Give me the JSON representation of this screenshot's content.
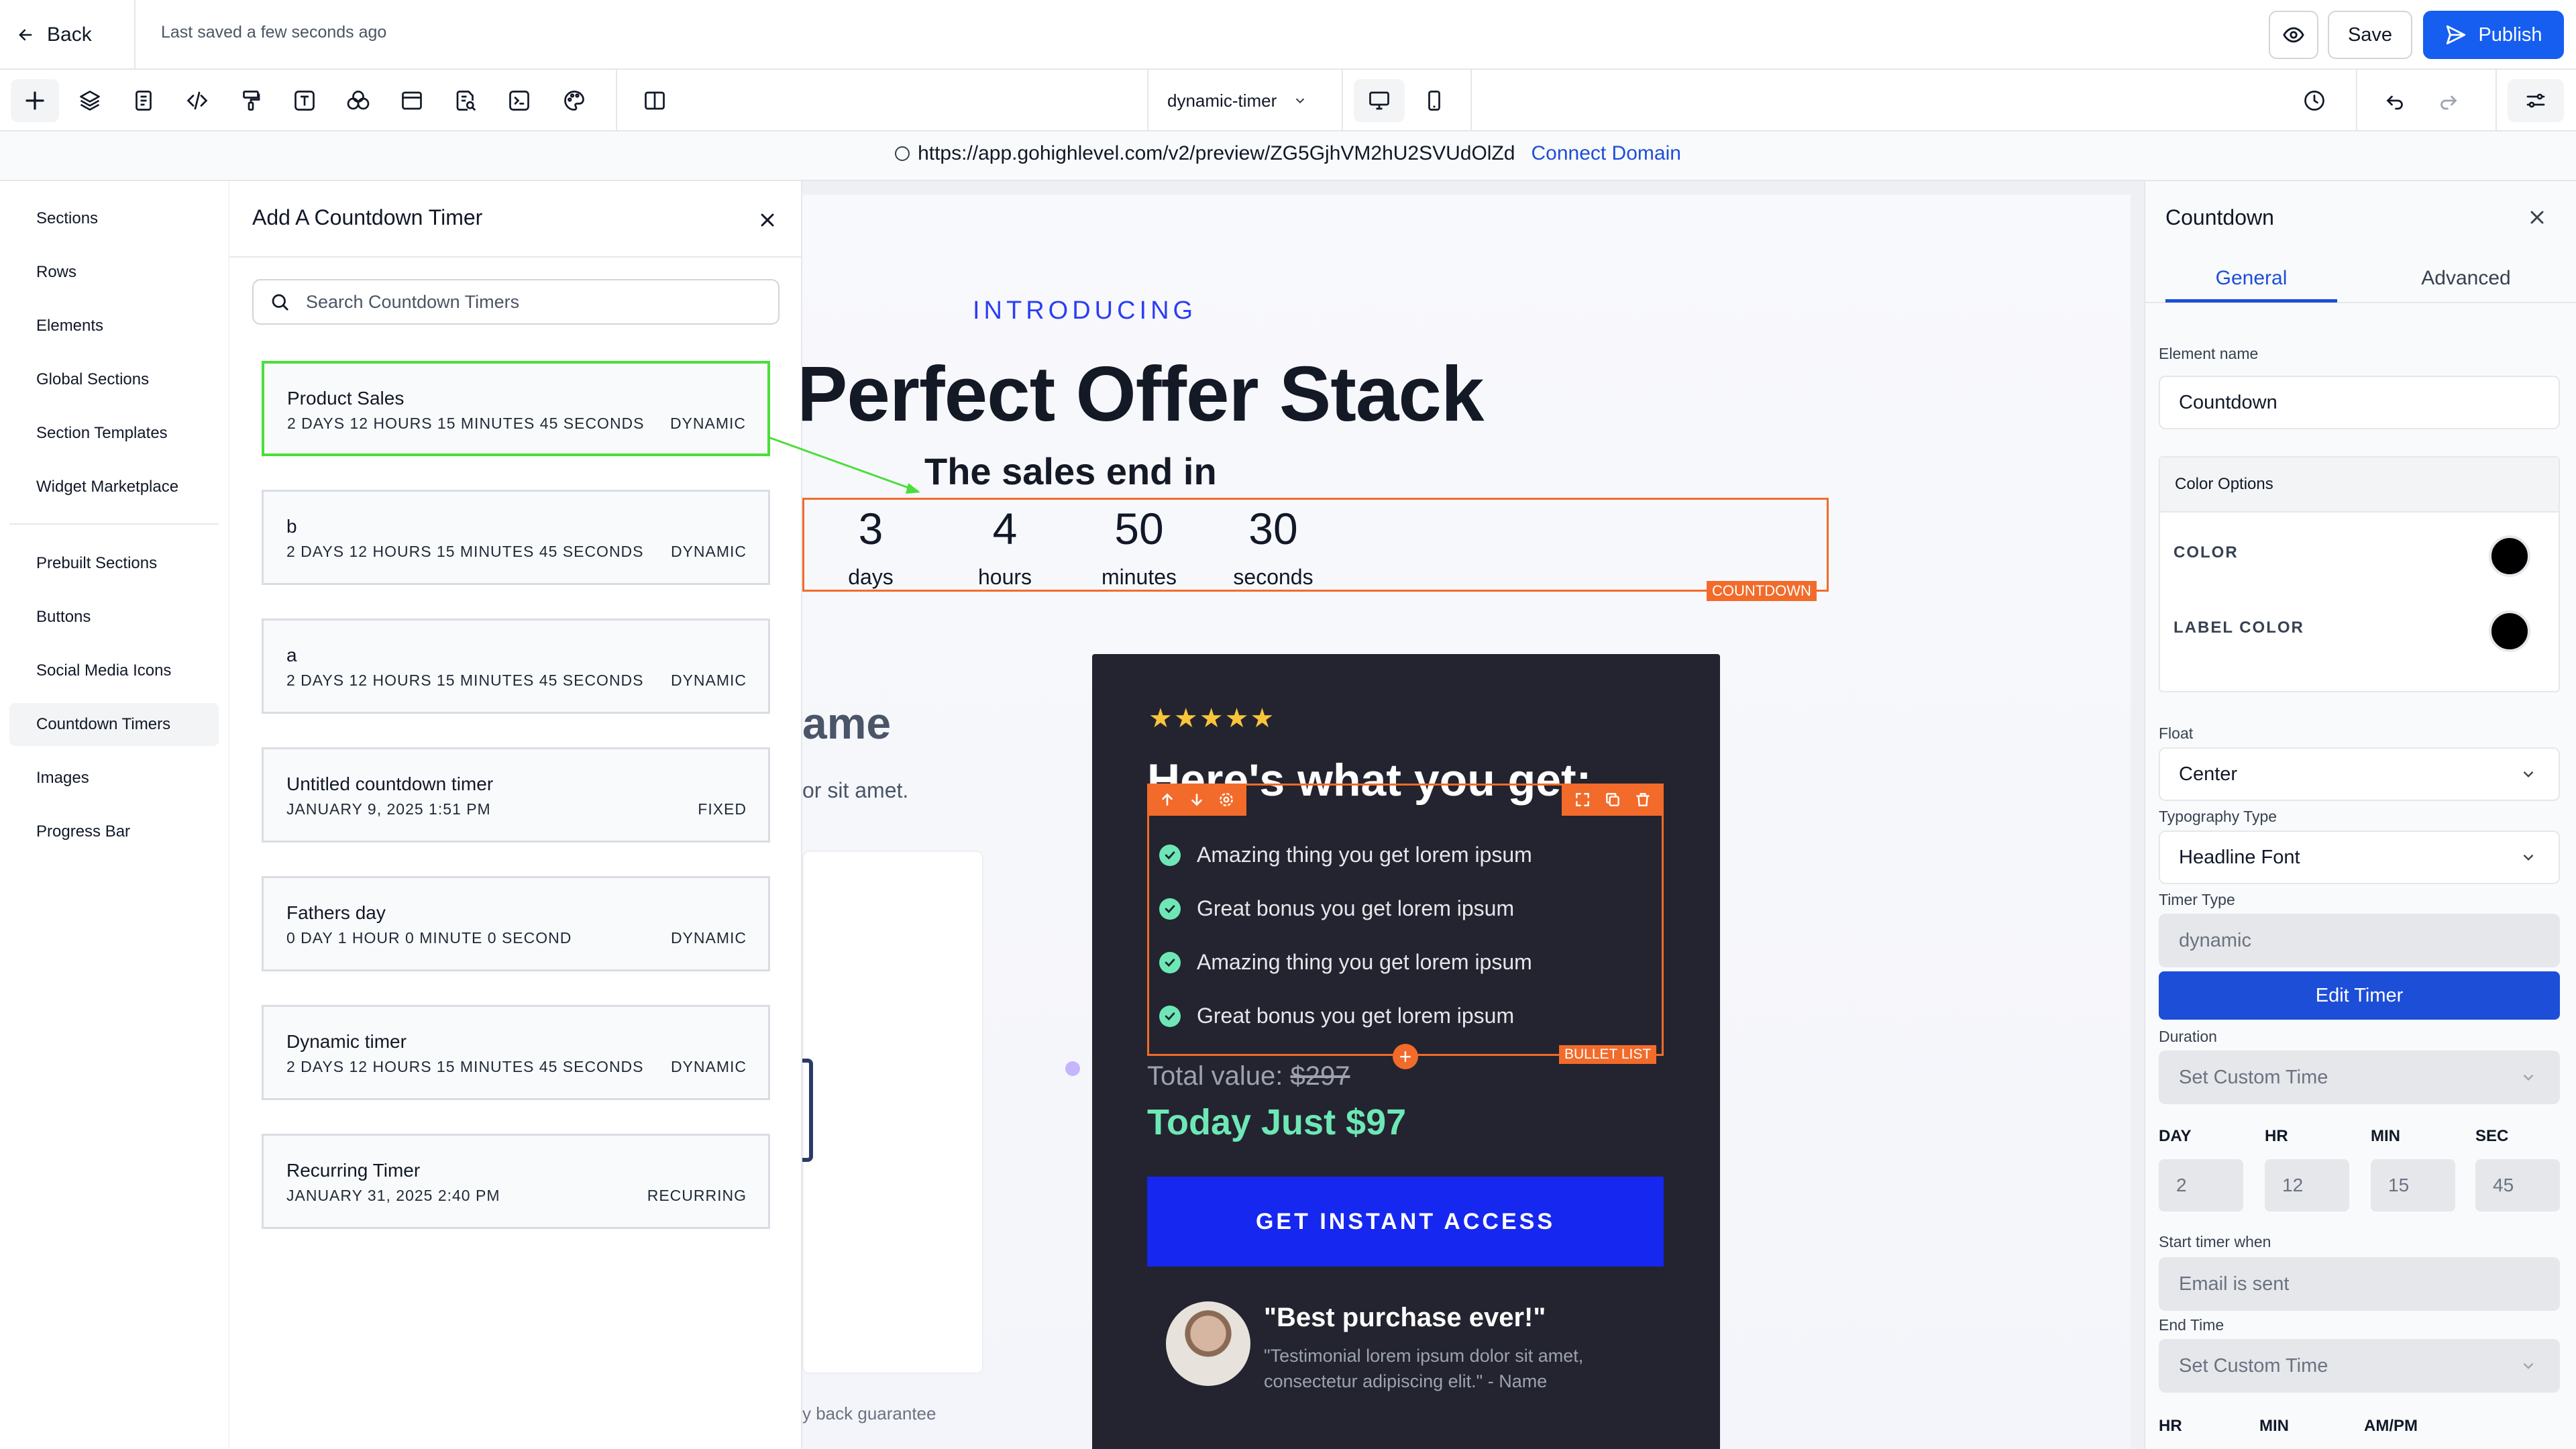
{
  "topbar": {
    "back_label": "Back",
    "saved_status": "Last saved a few seconds ago",
    "save_label": "Save",
    "publish_label": "Publish"
  },
  "toolbar": {
    "page_select_value": "dynamic-timer",
    "icons": [
      "plus-icon",
      "layers-icon",
      "page-icon",
      "code-icon",
      "paint-roller-icon",
      "text-icon",
      "shapes-icon",
      "layout-icon",
      "search-doc-icon",
      "terminal-icon",
      "palette-icon",
      "sidebar-toggle-icon"
    ]
  },
  "urlbar": {
    "url": "https://app.gohighlevel.com/v2/preview/ZG5GjhVM2hU2SVUdOlZd",
    "connect_domain": "Connect Domain"
  },
  "leftnav": {
    "items": [
      {
        "label": "Sections"
      },
      {
        "label": "Rows"
      },
      {
        "label": "Elements"
      },
      {
        "label": "Global Sections"
      },
      {
        "label": "Section Templates"
      },
      {
        "label": "Widget Marketplace"
      },
      {
        "label": "Prebuilt Sections"
      },
      {
        "label": "Buttons"
      },
      {
        "label": "Social Media Icons"
      },
      {
        "label": "Countdown Timers"
      },
      {
        "label": "Images"
      },
      {
        "label": "Progress Bar"
      }
    ],
    "active": "Countdown Timers"
  },
  "timer_panel": {
    "title": "Add A Countdown Timer",
    "search_placeholder": "Search Countdown Timers",
    "timers": [
      {
        "name": "Product Sales",
        "duration": "2 DAYS 12 HOURS 15 MINUTES 45 SECONDS",
        "type": "DYNAMIC"
      },
      {
        "name": "b",
        "duration": "2 DAYS 12 HOURS 15 MINUTES 45 SECONDS",
        "type": "DYNAMIC"
      },
      {
        "name": "a",
        "duration": "2 DAYS 12 HOURS 15 MINUTES 45 SECONDS",
        "type": "DYNAMIC"
      },
      {
        "name": "Untitled countdown timer",
        "duration": "JANUARY 9, 2025 1:51 PM",
        "type": "FIXED"
      },
      {
        "name": "Fathers day",
        "duration": "0 DAY 1 HOUR 0 MINUTE 0 SECOND",
        "type": "DYNAMIC"
      },
      {
        "name": "Dynamic timer",
        "duration": "2 DAYS 12 HOURS 15 MINUTES 45 SECONDS",
        "type": "DYNAMIC"
      },
      {
        "name": "Recurring Timer",
        "duration": "JANUARY 31, 2025 2:40 PM",
        "type": "RECURRING"
      }
    ]
  },
  "canvas": {
    "introducing": "INTRODUCING",
    "heading": "Perfect Offer Stack",
    "sales_end": "The sales end in",
    "countdown": [
      {
        "value": "3",
        "label": "days"
      },
      {
        "value": "4",
        "label": "hours"
      },
      {
        "value": "50",
        "label": "minutes"
      },
      {
        "value": "30",
        "label": "seconds"
      }
    ],
    "countdown_tag": "COUNTDOWN",
    "partial_heading": "ame",
    "partial_lorem": "or sit amet.",
    "partial_guarantee": "y back guarantee",
    "offer": {
      "stars": "★★★★★",
      "heading": "Here's what you get:",
      "bullets": [
        "Amazing thing you get lorem ipsum",
        "Great bonus you get lorem ipsum",
        "Amazing thing you get lorem ipsum",
        "Great bonus you get lorem ipsum"
      ],
      "bullet_tag": "BULLET LIST",
      "total_label": "Total value:",
      "total_strike": "$297",
      "today_price": "Today Just $97",
      "cta": "GET INSTANT ACCESS",
      "quote_title": "\"Best purchase ever!\"",
      "quote_text": "\"Testimonial lorem ipsum dolor sit amet, consectetur adipiscing elit.\" - Name"
    }
  },
  "right_panel": {
    "title": "Countdown",
    "tab_general": "General",
    "tab_advanced": "Advanced",
    "element_name_label": "Element name",
    "element_name_value": "Countdown",
    "color_options_label": "Color Options",
    "color_label": "COLOR",
    "label_color_label": "LABEL COLOR",
    "color_value": "#000000",
    "label_color_value": "#000000",
    "float_label": "Float",
    "float_value": "Center",
    "typography_label": "Typography Type",
    "typography_value": "Headline Font",
    "timer_type_label": "Timer Type",
    "timer_type_value": "dynamic",
    "edit_timer_label": "Edit Timer",
    "duration_label": "Duration",
    "duration_value": "Set Custom Time",
    "day_label": "DAY",
    "hr_label": "HR",
    "min_label": "MIN",
    "sec_label": "SEC",
    "day_value": "2",
    "hr_value": "12",
    "min_value": "15",
    "sec_value": "45",
    "start_when_label": "Start timer when",
    "start_when_value": "Email is sent",
    "end_time_label": "End Time",
    "end_time_value": "Set Custom Time",
    "bottom_hr": "HR",
    "bottom_min": "MIN",
    "bottom_ampm": "AM/PM"
  },
  "colors": {
    "accent": "#155eef",
    "selection_orange": "#f26b2a",
    "selected_card_green": "#4ade3a",
    "cta_blue": "#1627f0",
    "price_green": "#6ee7b7",
    "offer_card_bg": "#23242f"
  }
}
